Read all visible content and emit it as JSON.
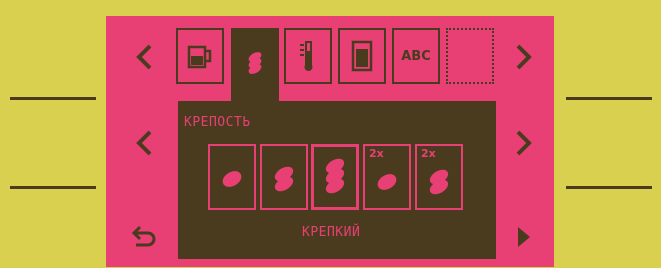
{
  "colors": {
    "bezel": "#d8d04e",
    "screen": "#e83f74",
    "ink": "#4a3b1f"
  },
  "tabs": [
    {
      "icon": "cup-icon"
    },
    {
      "icon": "bean-icon",
      "selected": true
    },
    {
      "icon": "thermometer-icon"
    },
    {
      "icon": "water-container-icon"
    },
    {
      "icon": "abc-text-icon",
      "text": "ABC"
    },
    {
      "icon": "empty-slot"
    }
  ],
  "section_title": "КРЕПОСТЬ",
  "strength_levels": [
    {
      "beans": 1,
      "double": false
    },
    {
      "beans": 2,
      "double": false
    },
    {
      "beans": 3,
      "double": false,
      "selected": true
    },
    {
      "beans": 1,
      "double": true,
      "double_label": "2x"
    },
    {
      "beans": 2,
      "double": true,
      "double_label": "2x"
    }
  ],
  "current_value": "КРЕПКИЙ",
  "nav": {
    "prev_tab": "chevron-left",
    "next_tab": "chevron-right",
    "prev_value": "chevron-left",
    "next_value": "chevron-right",
    "back": "back-arrow",
    "forward": "play-triangle"
  }
}
